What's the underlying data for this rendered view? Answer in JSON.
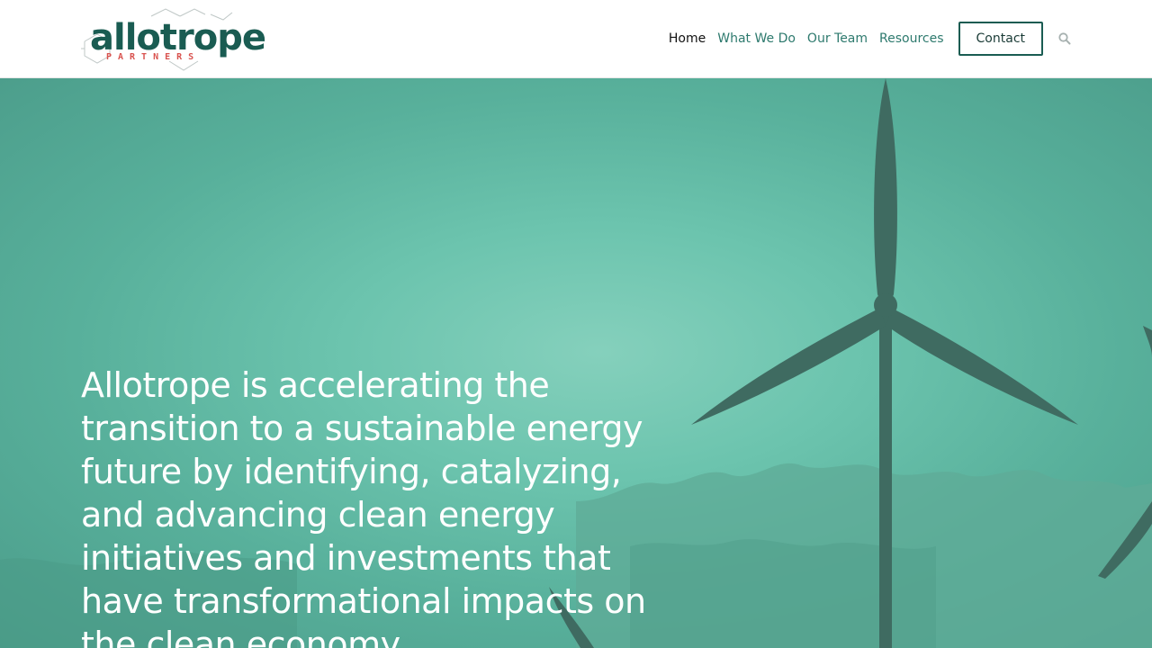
{
  "brand": {
    "logo_word": "allotrope",
    "logo_sub": "PARTNERS",
    "colors": {
      "primary": "#1a5c52",
      "accent": "#d9534f"
    }
  },
  "nav": {
    "items": [
      {
        "label": "Home",
        "active": true
      },
      {
        "label": "What We Do",
        "active": false
      },
      {
        "label": "Our Team",
        "active": false
      },
      {
        "label": "Resources",
        "active": false
      }
    ],
    "contact_label": "Contact",
    "search_icon": "search-icon"
  },
  "hero": {
    "headline": "Allotrope is accelerating the transition to a sustainable energy future by identifying, catalyzing, and advancing clean energy initiatives and investments that have transformational impacts on the clean economy."
  }
}
